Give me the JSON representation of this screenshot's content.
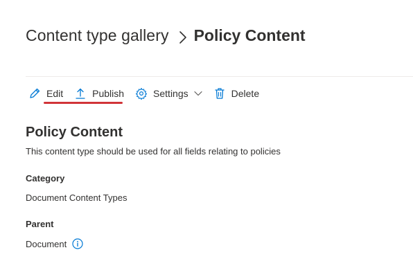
{
  "breadcrumb": {
    "parent": "Content type gallery",
    "current": "Policy Content",
    "separator_icon": "chevron-right-icon"
  },
  "toolbar": {
    "edit_label": "Edit",
    "edit_icon": "pencil-icon",
    "publish_label": "Publish",
    "publish_icon": "upload-icon",
    "settings_label": "Settings",
    "settings_icon": "gear-icon",
    "delete_label": "Delete",
    "delete_icon": "trash-icon"
  },
  "content": {
    "title": "Policy Content",
    "description": "This content type should be used for all fields relating to policies",
    "category_label": "Category",
    "category_value": "Document Content Types",
    "parent_label": "Parent",
    "parent_value": "Document"
  },
  "colors": {
    "accent": "#0078d4",
    "highlight_underline": "#d13438",
    "text": "#323130",
    "divider": "#edebe9"
  }
}
